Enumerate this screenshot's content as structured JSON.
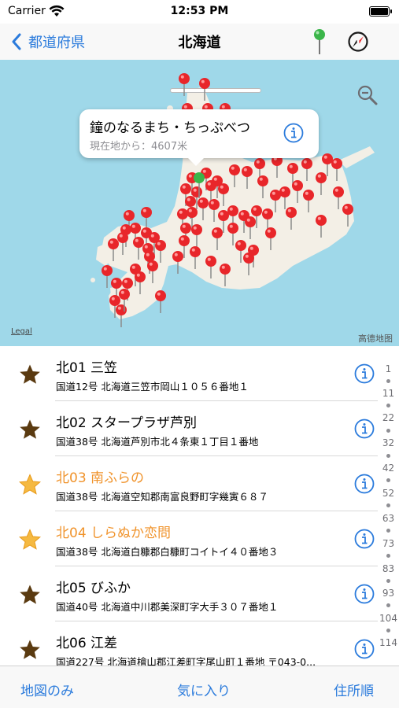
{
  "status_bar": {
    "carrier": "Carrier",
    "time": "12:53 PM"
  },
  "nav": {
    "back_label": "都道府県",
    "title": "北海道"
  },
  "map": {
    "legal": "Legal",
    "provider": "高德地图",
    "callout": {
      "title": "鐘のなるまち・ちっぷべつ",
      "subtitle": "現在地から：4607米"
    }
  },
  "stations": [
    {
      "name": "北01 三笠",
      "address": "国道12号 北海道三笠市岡山１０５６番地１",
      "favorite": false
    },
    {
      "name": "北02 スタープラザ芦別",
      "address": "国道38号 北海道芦別市北４条東１丁目１番地",
      "favorite": false
    },
    {
      "name": "北03 南ふらの",
      "address": "国道38号 北海道空知郡南富良野町字幾寅６８７",
      "favorite": true
    },
    {
      "name": "北04 しらぬか恋問",
      "address": "国道38号 北海道白糠郡白糠町コイトイ４０番地３",
      "favorite": true
    },
    {
      "name": "北05 びふか",
      "address": "国道40号 北海道中川郡美深町字大手３０７番地１",
      "favorite": false
    },
    {
      "name": "北06 江差",
      "address": "国道227号 北海道檜山郡江差町字尾山町１番地 〒043-0...",
      "favorite": false
    }
  ],
  "section_index": [
    "1",
    "11",
    "22",
    "32",
    "42",
    "52",
    "63",
    "73",
    "83",
    "93",
    "104",
    "114"
  ],
  "toolbar": {
    "map_only": "地図のみ",
    "favorites": "気に入り",
    "address_order": "住所順"
  },
  "colors": {
    "accent": "#2b7bdc",
    "favorite_text": "#f0932b",
    "star_dark": "#5a3a10",
    "star_gold": "#f5b941",
    "pin": "#e8262a",
    "water": "#9fd8e9",
    "land": "#f3efe6"
  }
}
